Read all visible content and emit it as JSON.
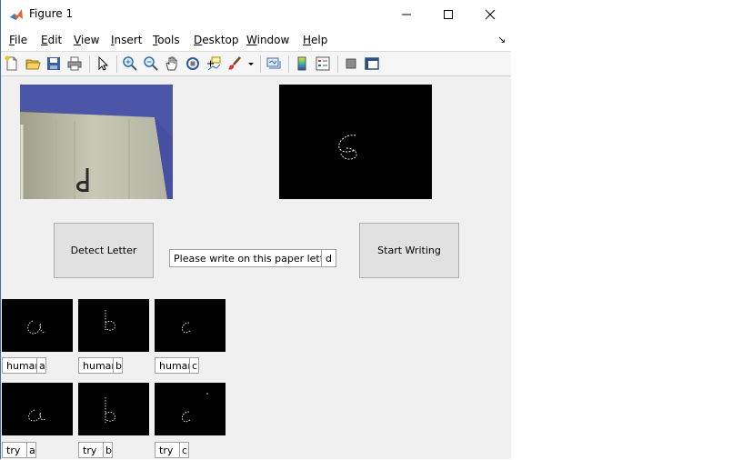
{
  "window": {
    "title": "Figure 1"
  },
  "menu": {
    "items": [
      "File",
      "Edit",
      "View",
      "Insert",
      "Tools",
      "Desktop",
      "Window",
      "Help"
    ]
  },
  "toolbar": {
    "icons": [
      "new-figure-icon",
      "open-file-icon",
      "save-icon",
      "print-icon",
      "edit-plot-arrow-icon",
      "zoom-in-icon",
      "zoom-out-icon",
      "pan-hand-icon",
      "rotate-3d-icon",
      "data-cursor-icon",
      "brush-icon",
      "brush-dropdown-icon",
      "link-plot-icon",
      "colorbar-icon",
      "legend-icon",
      "hide-plot-tools-icon",
      "show-plot-tools-icon"
    ]
  },
  "main": {
    "detect_button": "Detect Letter",
    "start_button": "Start Writing",
    "prompt_text": "Please write on this paper letter",
    "prompt_letter": "d"
  },
  "samples": {
    "human": [
      {
        "label": "human",
        "letter": "a"
      },
      {
        "label": "human",
        "letter": "b"
      },
      {
        "label": "human",
        "letter": "c"
      }
    ],
    "try": [
      {
        "label": "try",
        "letter": "a"
      },
      {
        "label": "try",
        "letter": "b"
      },
      {
        "label": "try",
        "letter": "c"
      }
    ]
  },
  "colors": {
    "axes_bg": "#000000",
    "window_bg": "#f0f0f0",
    "button_bg": "#e1e1e1",
    "accent": "#3a6ea5"
  }
}
